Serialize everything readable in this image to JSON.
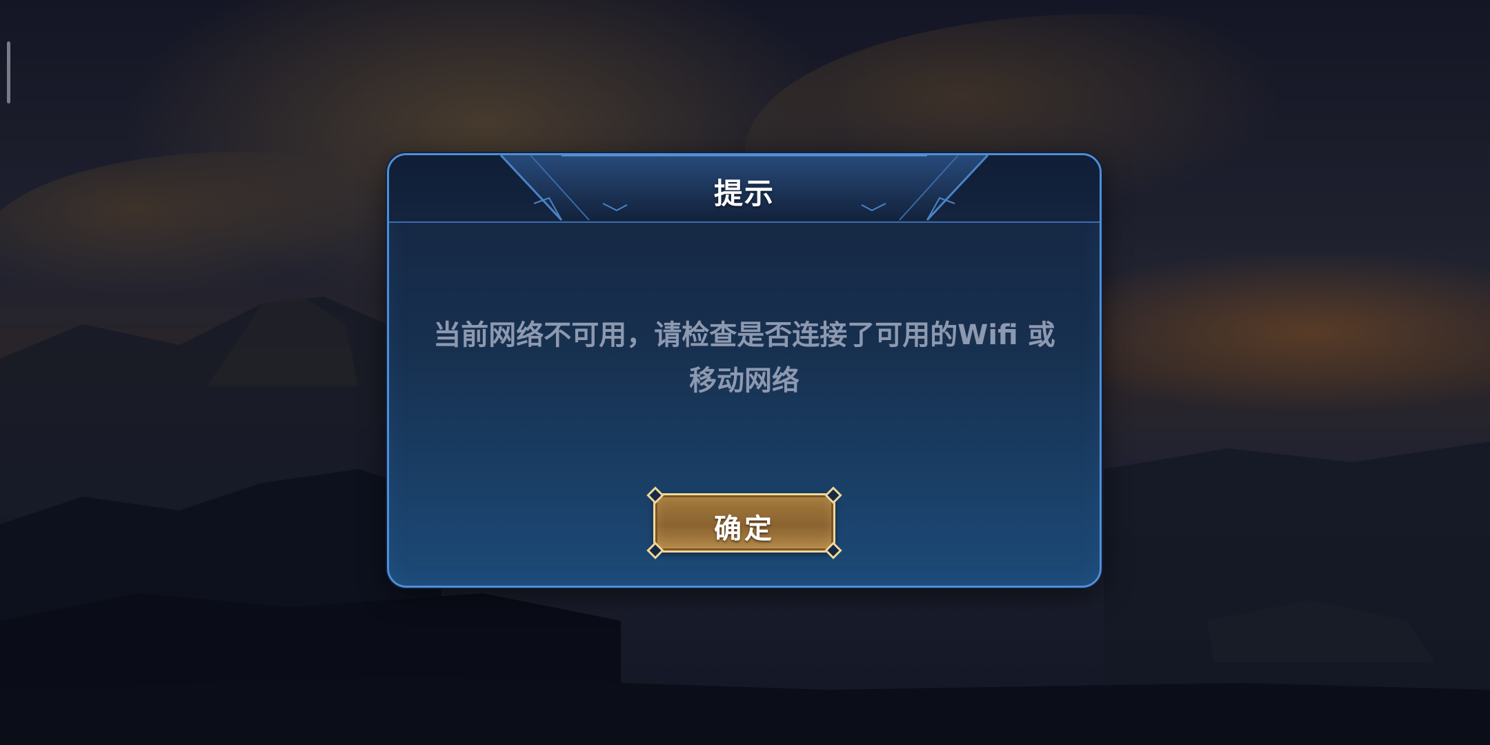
{
  "dialog": {
    "title": "提示",
    "message": "当前网络不可用，请检查是否连接了可用的Wifi 或移动网络",
    "confirm_label": "确定"
  },
  "colors": {
    "dialog_border": "#4f8fd6",
    "dialog_top": "#152540",
    "dialog_bottom": "#1c4a78",
    "message_text": "#8d99b0",
    "button_gold": "#a47a3d",
    "button_border": "#f1d79a"
  }
}
